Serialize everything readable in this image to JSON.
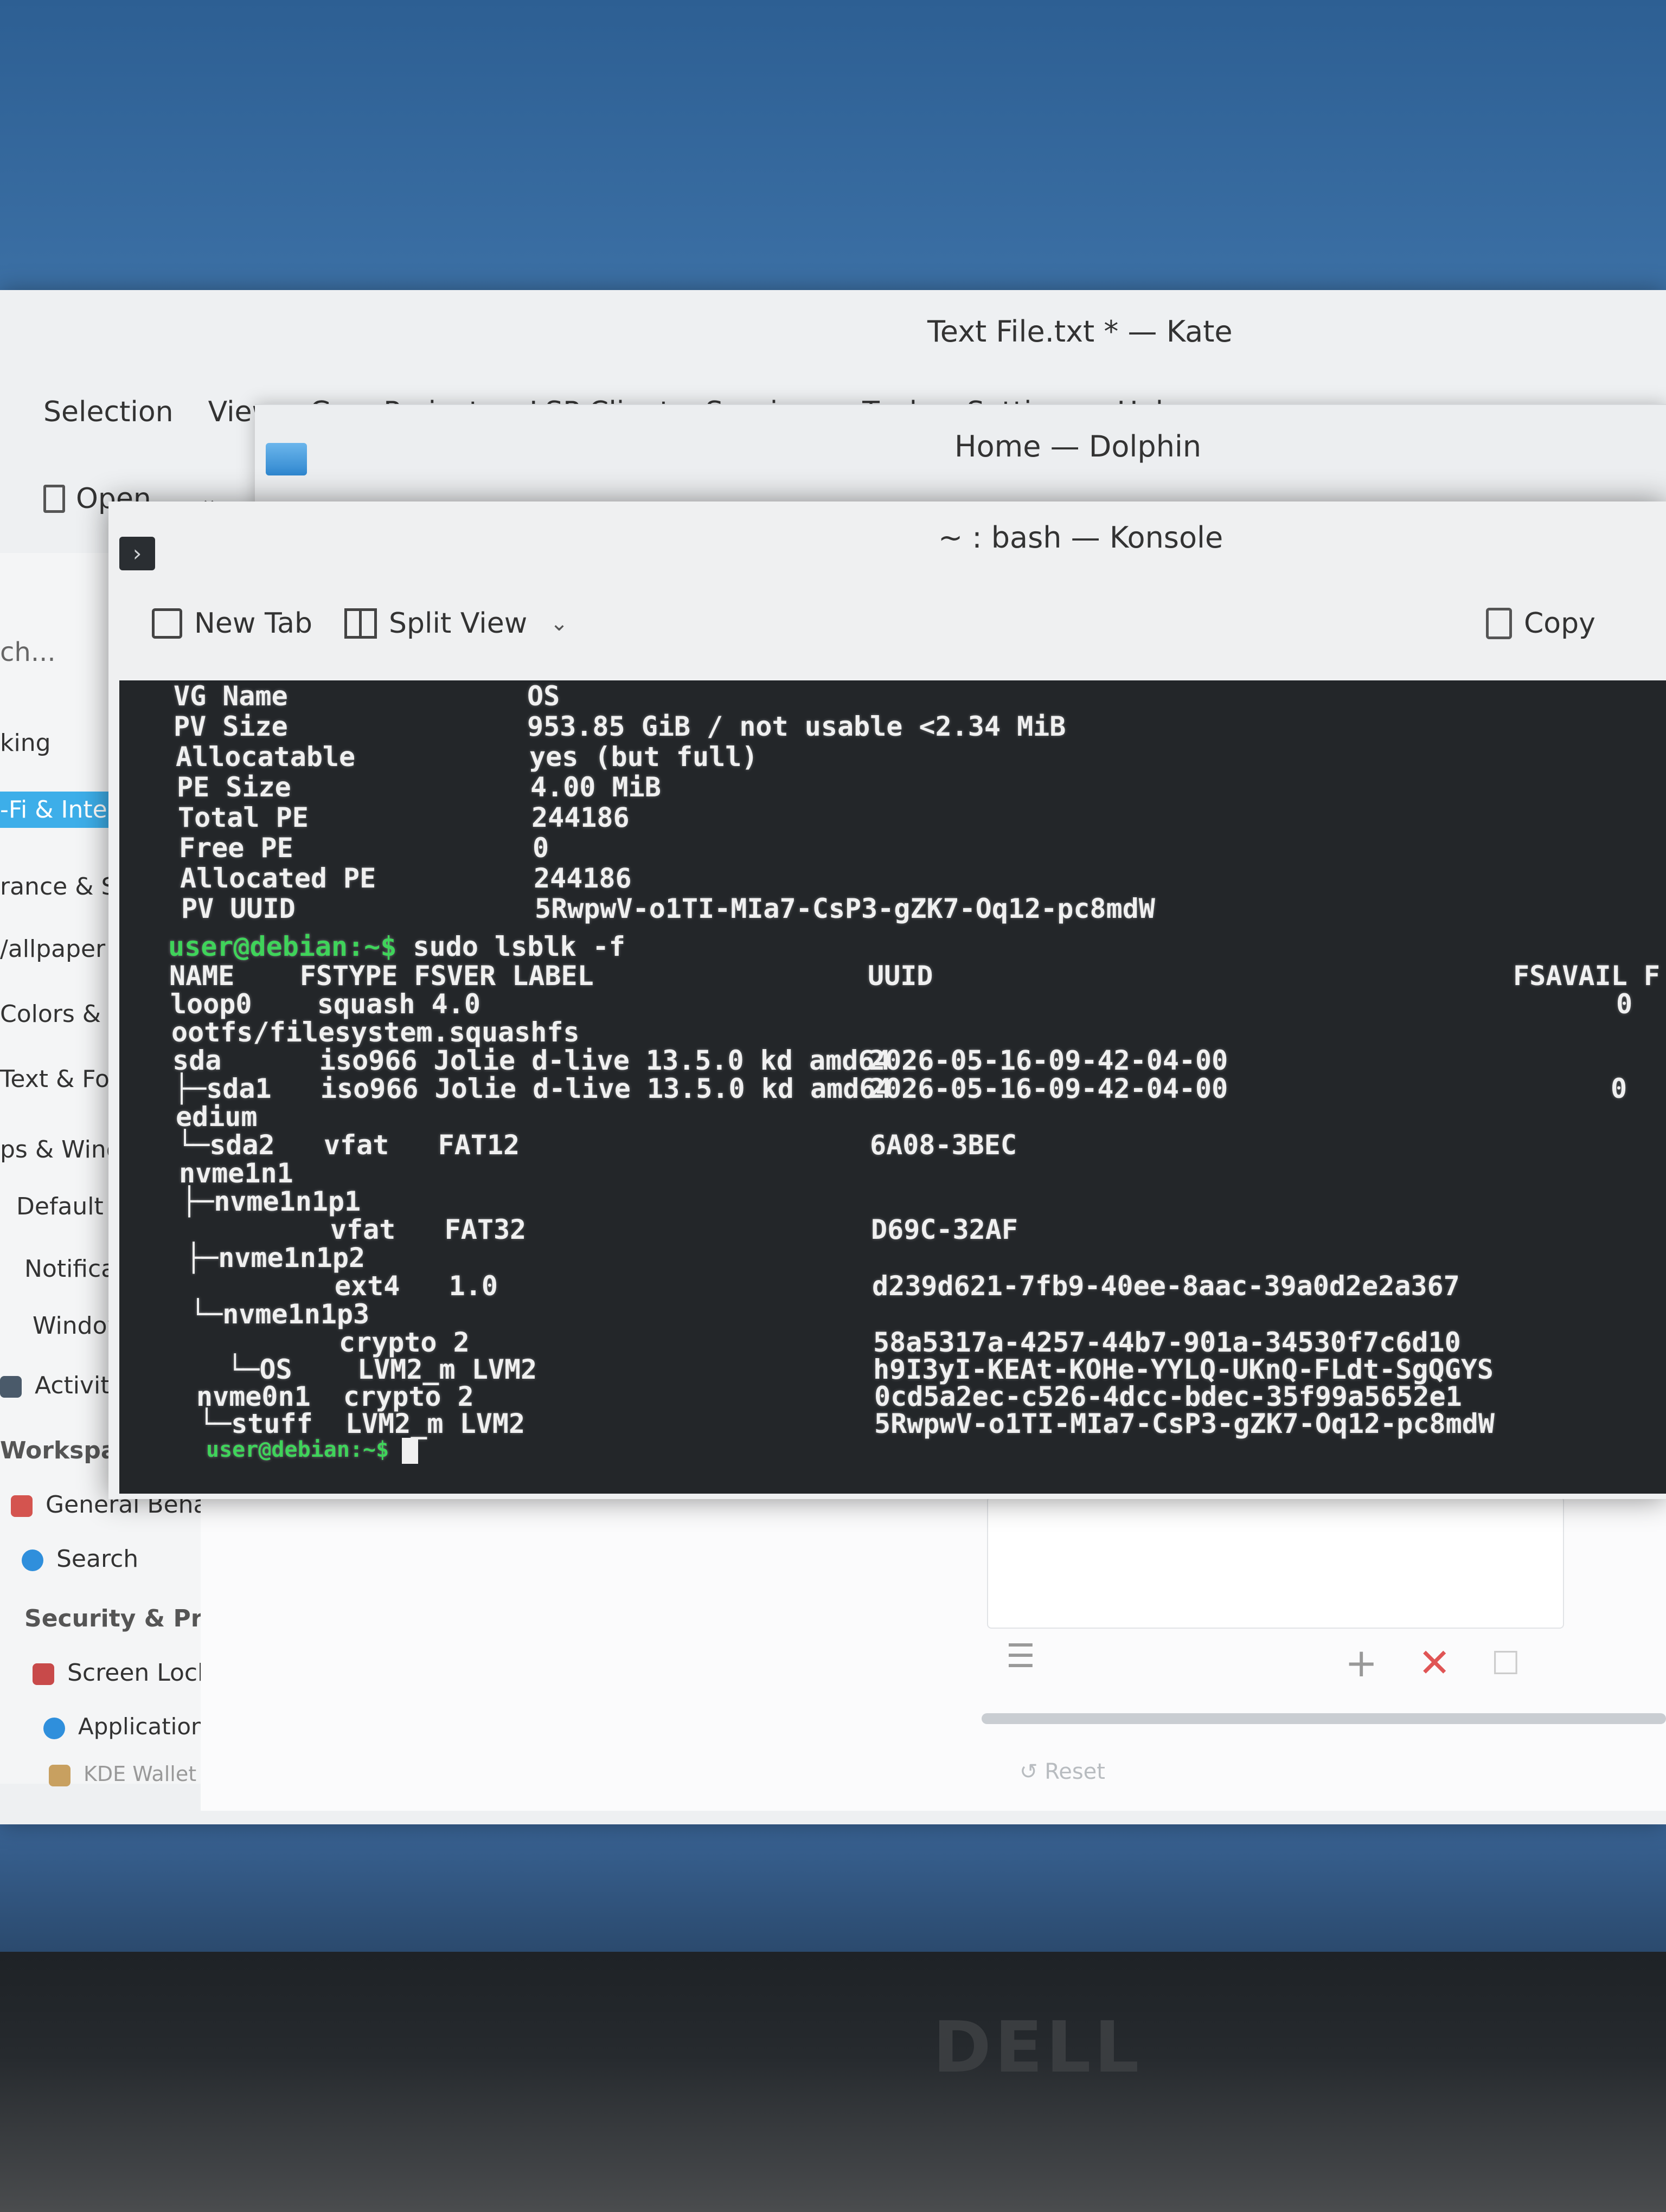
{
  "kate": {
    "title": "Text File.txt * — Kate",
    "menu": [
      "Selection",
      "View",
      "Go",
      "Projects",
      "LSP Client",
      "Sessions",
      "Tools",
      "Settings",
      "Help"
    ],
    "open_button": "Open..."
  },
  "dolphin": {
    "title": "Home — Dolphin"
  },
  "settings": {
    "search_placeholder": "ch...",
    "sidebar": [
      "king",
      "-Fi & Intern",
      "rance & Sty",
      "/allpaper",
      "Colors & Then",
      "Text & Fonts",
      "ps & Windows",
      "Default Applic",
      "Notifications",
      "Window Mana",
      "Activities",
      "Workspace",
      "General Behavior",
      "Search",
      "Security & Privacy",
      "Screen Locking",
      "Application Permissions",
      "KDE Wallet"
    ],
    "reset_label": "Reset"
  },
  "konsole": {
    "title": "~ : bash — Konsole",
    "toolbar": {
      "new_tab": "New Tab",
      "split_view": "Split View",
      "copy": "Copy"
    },
    "pvdisplay": [
      {
        "key": "VG Name",
        "value": "OS"
      },
      {
        "key": "PV Size",
        "value": "953.85 GiB / not usable <2.34 MiB"
      },
      {
        "key": "Allocatable",
        "value": "yes (but full)"
      },
      {
        "key": "PE Size",
        "value": "4.00 MiB"
      },
      {
        "key": "Total PE",
        "value": "244186"
      },
      {
        "key": "Free PE",
        "value": "0"
      },
      {
        "key": "Allocated PE",
        "value": "244186"
      },
      {
        "key": "PV UUID",
        "value": "5RwpwV-o1TI-MIa7-CsP3-gZK7-Oq12-pc8mdW"
      }
    ],
    "prompt": "user@debian:~$",
    "command": " sudo lsblk -f",
    "lsblk_header": {
      "name_cols": "NAME    FSTYPE FSVER LABEL",
      "uuid": "UUID",
      "fsavail": "FSAVAIL F"
    },
    "lsblk_rows": [
      {
        "text": "loop0    squash 4.0",
        "uuid": "",
        "avail": "0"
      },
      {
        "text": "ootfs/filesystem.squashfs",
        "uuid": "",
        "avail": ""
      },
      {
        "text": "sda      iso966 Jolie d-live 13.5.0 kd amd64",
        "uuid": "2026-05-16-09-42-04-00",
        "avail": ""
      },
      {
        "text": "├─sda1   iso966 Jolie d-live 13.5.0 kd amd64",
        "uuid": "2026-05-16-09-42-04-00",
        "avail": "0"
      },
      {
        "text": "edium",
        "uuid": "",
        "avail": ""
      },
      {
        "text": "└─sda2   vfat   FAT12",
        "uuid": "6A08-3BEC",
        "avail": ""
      },
      {
        "text": "nvme1n1",
        "uuid": "",
        "avail": ""
      },
      {
        "text": "├─nvme1n1p1",
        "uuid": "",
        "avail": ""
      },
      {
        "text": "         vfat   FAT32",
        "uuid": "D69C-32AF",
        "avail": ""
      },
      {
        "text": "├─nvme1n1p2",
        "uuid": "",
        "avail": ""
      },
      {
        "text": "         ext4   1.0",
        "uuid": "d239d621-7fb9-40ee-8aac-39a0d2e2a367",
        "avail": ""
      },
      {
        "text": "└─nvme1n1p3",
        "uuid": "",
        "avail": ""
      },
      {
        "text": "         crypto 2",
        "uuid": "58a5317a-4257-44b7-901a-34530f7c6d10",
        "avail": ""
      },
      {
        "text": "  └─OS    LVM2_m LVM2",
        "uuid": "h9I3yI-KEAt-KOHe-YYLQ-UKnQ-FLdt-SgQGYS",
        "avail": ""
      },
      {
        "text": "nvme0n1  crypto 2",
        "uuid": "0cd5a2ec-c526-4dcc-bdec-35f99a5652e1",
        "avail": ""
      },
      {
        "text": "└─stuff  LVM2_m LVM2",
        "uuid": "5RwpwV-o1TI-MIa7-CsP3-gZK7-Oq12-pc8mdW",
        "avail": ""
      }
    ],
    "final_prompt": "user@debian:~$"
  },
  "bezel": {
    "logo": "DELL"
  },
  "colors": {
    "terminal_bg": "#232629",
    "prompt_green": "#3fd35a",
    "accent": "#3daee9"
  }
}
